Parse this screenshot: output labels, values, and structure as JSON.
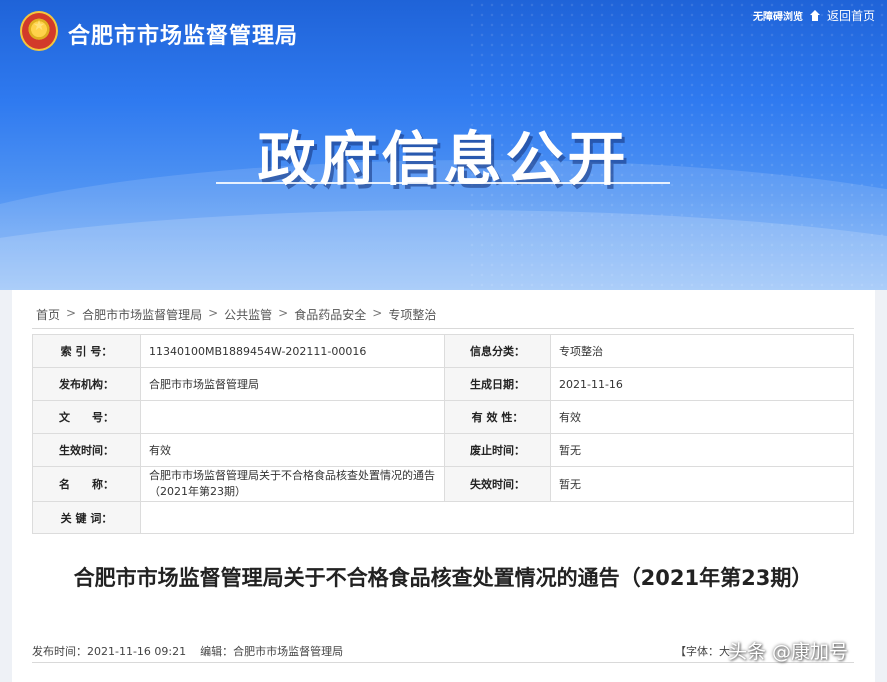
{
  "header": {
    "site_name": "合肥市市场监督管理局",
    "accessibility_label": "无障碍浏览",
    "back_home_label": "返回首页",
    "banner_title": "政府信息公开"
  },
  "breadcrumb": [
    "首页",
    "合肥市市场监督管理局",
    "公共监管",
    "食品药品安全",
    "专项整治"
  ],
  "breadcrumb_separator": ">",
  "meta_table": {
    "index_label": "索 引 号：",
    "index_value": "11340100MB1889454W-202111-00016",
    "category_label": "信息分类：",
    "category_value": "专项整治",
    "publisher_label": "发布机构：",
    "publisher_value": "合肥市市场监督管理局",
    "created_label": "生成日期：",
    "created_value": "2021-11-16",
    "docno_label": "文　　号：",
    "docno_value": "",
    "validity_label": "有 效 性：",
    "validity_value": "有效",
    "effective_label": "生效时间：",
    "effective_value": "有效",
    "repeal_label": "废止时间：",
    "repeal_value": "暂无",
    "name_label": "名　　称：",
    "name_value": "合肥市市场监督管理局关于不合格食品核查处置情况的通告（2021年第23期）",
    "expire_label": "失效时间：",
    "expire_value": "暂无",
    "keywords_label": "关 键 词：",
    "keywords_value": ""
  },
  "article": {
    "title": "合肥市市场监督管理局关于不合格食品核查处置情况的通告（2021年第23期）",
    "publish_time_label": "发布时间：",
    "publish_time": "2021-11-16 09:21",
    "editor_label": "编辑：",
    "editor": "合肥市市场监督管理局",
    "font_size_label": "【字体：大"
  },
  "watermark": "头条 @康加号",
  "colors": {
    "banner_top": "#1f63d8",
    "banner_bottom": "#8fbdf7",
    "table_border": "#dcdcdc"
  }
}
